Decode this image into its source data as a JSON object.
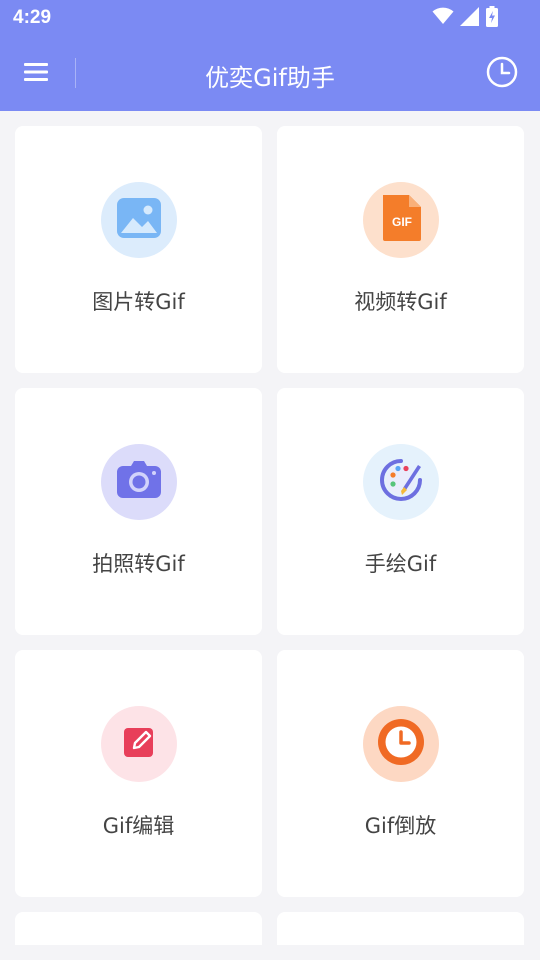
{
  "status_bar": {
    "time": "4:29",
    "icons": [
      "wifi-icon",
      "signal-icon",
      "battery-charging-icon"
    ]
  },
  "app_bar": {
    "title": "优奕Gif助手",
    "menu_icon": "menu-icon",
    "history_icon": "clock-icon"
  },
  "tools": [
    {
      "label": "图片转Gif",
      "icon": "image-icon",
      "icon_bg": "#dcecfc"
    },
    {
      "label": "视频转Gif",
      "icon": "gif-file-icon",
      "icon_bg": "#fde0cc"
    },
    {
      "label": "拍照转Gif",
      "icon": "camera-icon",
      "icon_bg": "#dcdcfa"
    },
    {
      "label": "手绘Gif",
      "icon": "paint-palette-icon",
      "icon_bg": "#e5f2fc"
    },
    {
      "label": "Gif编辑",
      "icon": "edit-icon",
      "icon_bg": "#fde3e7"
    },
    {
      "label": "Gif倒放",
      "icon": "clock-reverse-icon",
      "icon_bg": "#fdd8c3"
    }
  ],
  "colors": {
    "primary": "#7b8af3",
    "background": "#f4f4f7",
    "card": "#ffffff",
    "label_text": "#444444"
  },
  "gif_badge_text": "GIF"
}
